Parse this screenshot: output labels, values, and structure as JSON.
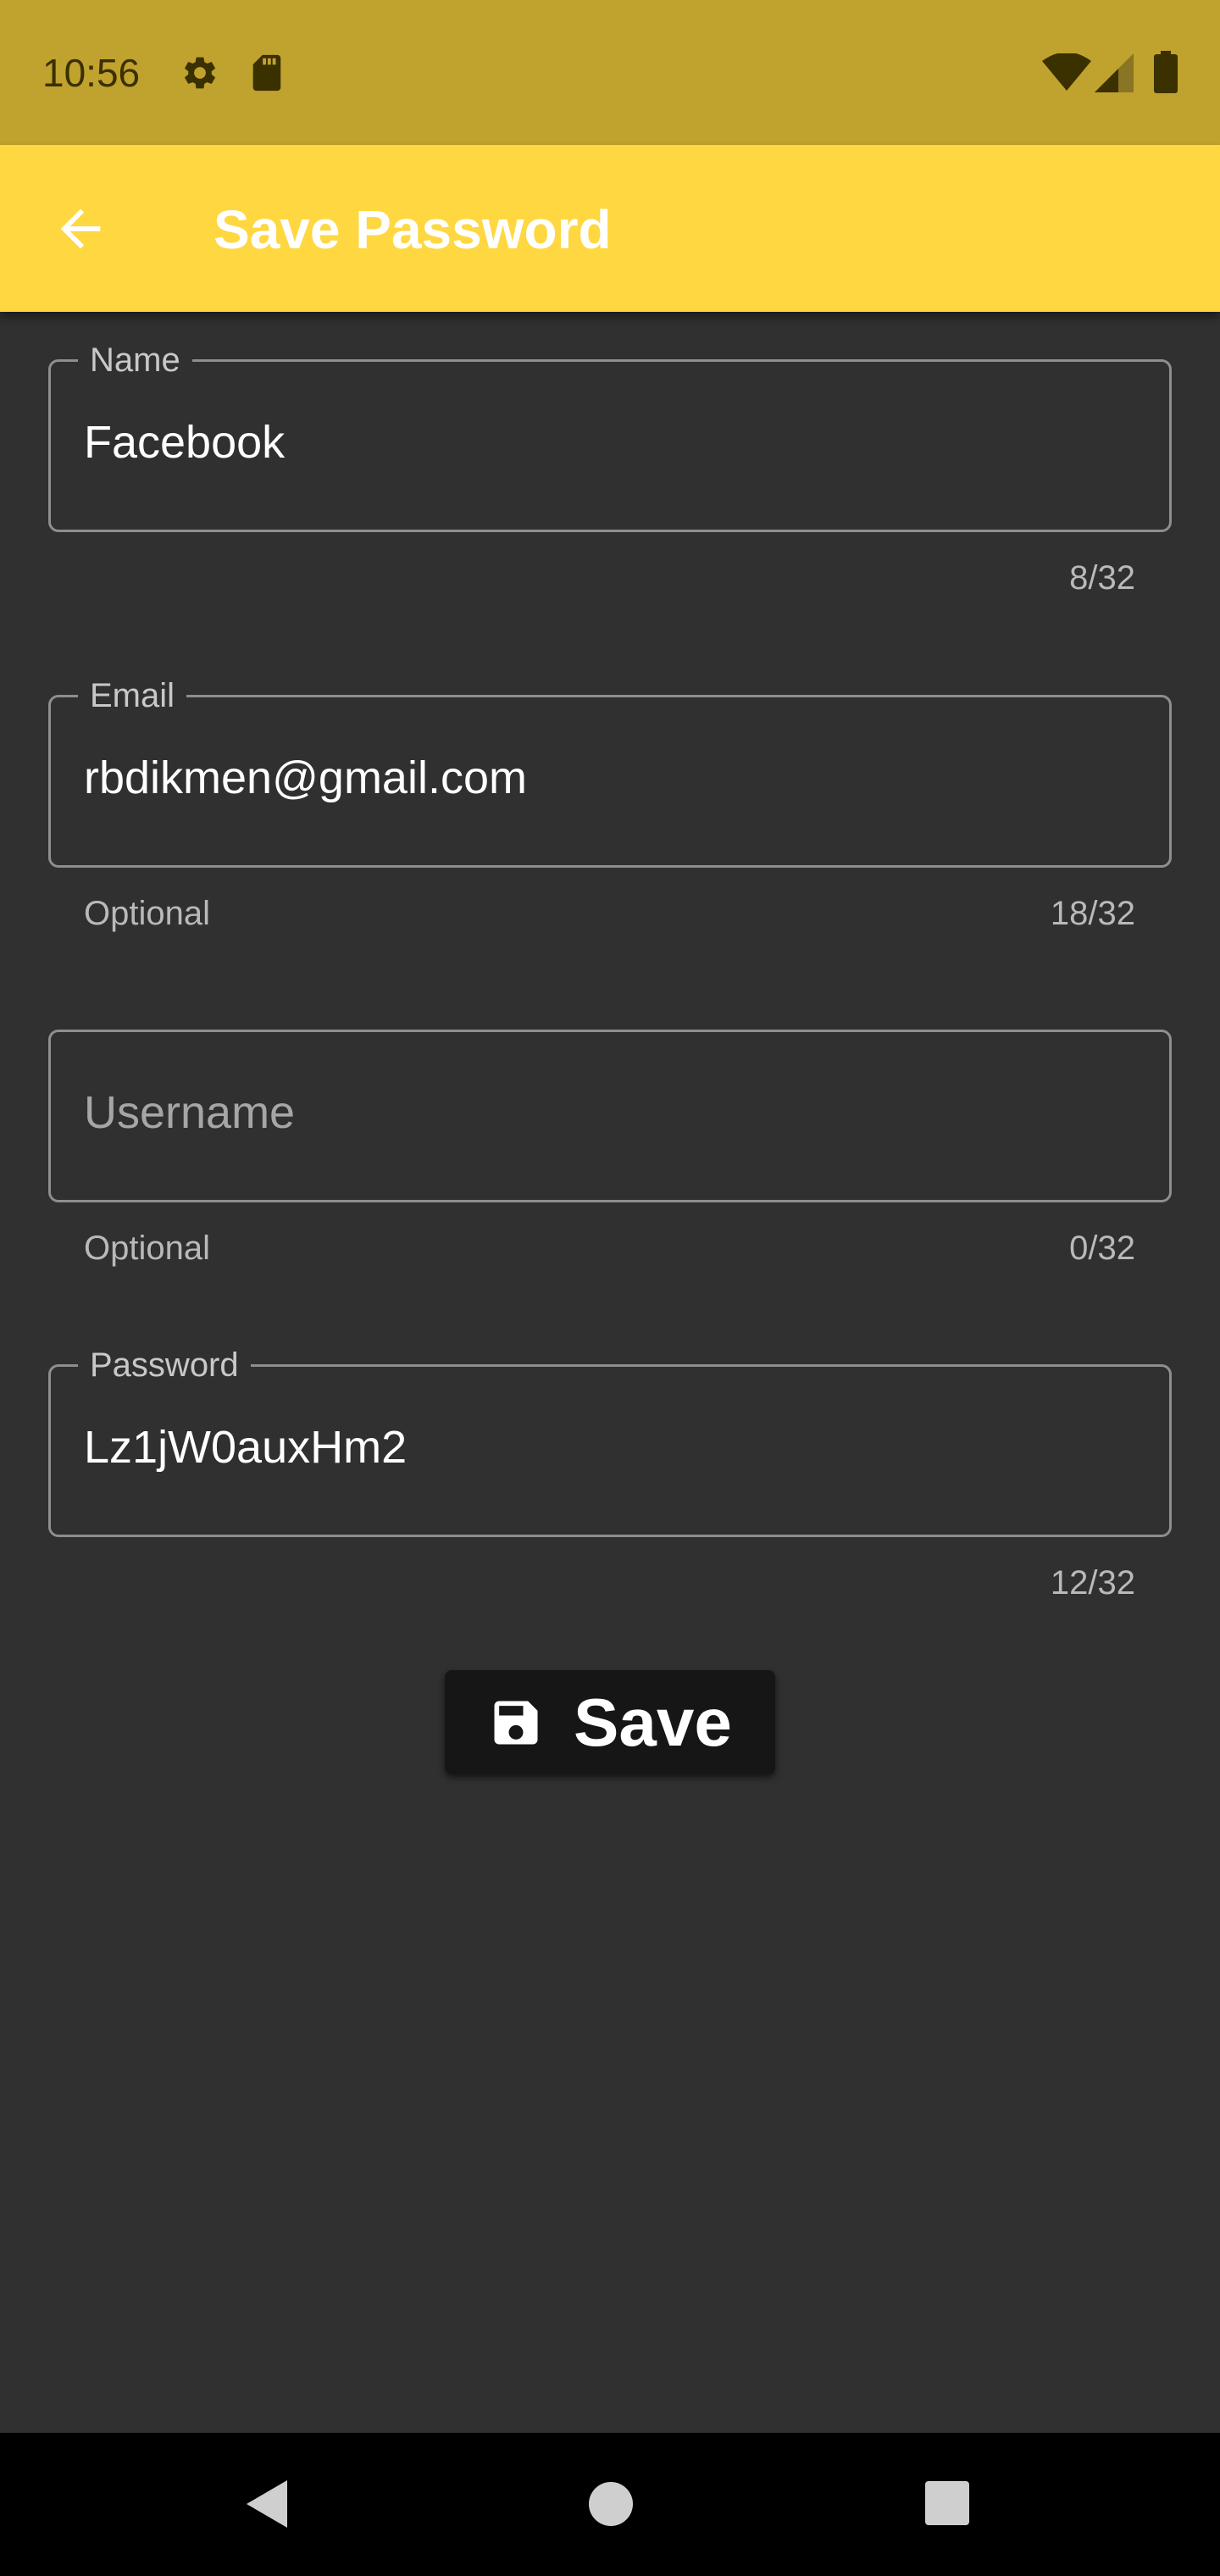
{
  "status_bar": {
    "time": "10:56",
    "left_icons": [
      "gear-icon",
      "sd-card-icon"
    ],
    "right_icons": [
      "wifi-icon",
      "cell-signal-icon",
      "battery-icon"
    ],
    "color": "#C0A22E"
  },
  "app_bar": {
    "title": "Save Password",
    "back_icon": "arrow-back-icon",
    "color": "#FFD741"
  },
  "form": {
    "name": {
      "label": "Name",
      "value": "Facebook",
      "helper": "",
      "counter": "8/32"
    },
    "email": {
      "label": "Email",
      "value": "rbdikmen@gmail.com",
      "helper": "Optional",
      "counter": "18/32"
    },
    "username": {
      "label": "",
      "value": "",
      "placeholder": "Username",
      "helper": "Optional",
      "counter": "0/32"
    },
    "password": {
      "label": "Password",
      "value": "Lz1jW0auxHm2",
      "helper": "",
      "counter": "12/32"
    }
  },
  "save_button": {
    "label": "Save",
    "icon": "floppy-disk-icon"
  },
  "nav_bar": {
    "icons": [
      "nav-back-icon",
      "nav-home-icon",
      "nav-recents-icon"
    ]
  },
  "colors": {
    "background": "#303030",
    "outline": "#8e8e8e",
    "button": "#161616"
  }
}
